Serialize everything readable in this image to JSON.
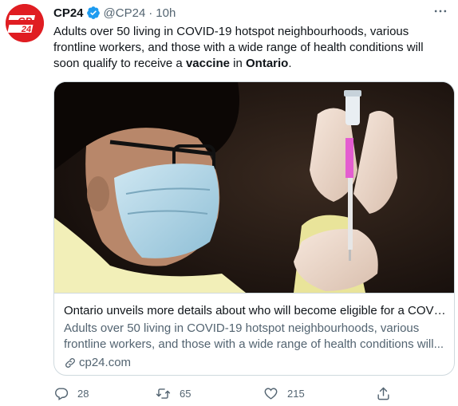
{
  "author": {
    "name": "CP24",
    "handle": "@CP24",
    "separator": "·",
    "time": "10h",
    "avatar_logo_text": "CP24",
    "verified": true
  },
  "tweet": {
    "text_part1": "Adults over 50 living in COVID-19 hotspot neighbourhoods, various frontline workers, and those with a wide range of health conditions will soon qualify to receive a ",
    "bold1": "vaccine",
    "text_part2": " in ",
    "bold2": "Ontario",
    "text_part3": "."
  },
  "card": {
    "image_alt": "Health worker wearing a mask and gloves preparing a vaccine syringe",
    "title": "Ontario unveils more details about who will become eligible for a COVI...",
    "description": "Adults over 50 living in COVID-19 hotspot neighbourhoods, various frontline workers, and those with a wide range of health conditions will...",
    "domain": "cp24.com"
  },
  "actions": {
    "replies": "28",
    "retweets": "65",
    "likes": "215"
  },
  "colors": {
    "brand_red": "#e01d22",
    "verified_blue": "#1d9bf0",
    "secondary_text": "#536471",
    "border": "#cfd9de"
  },
  "icons": [
    "verified-badge-icon",
    "more-icon",
    "link-icon",
    "reply-icon",
    "retweet-icon",
    "like-icon",
    "share-icon"
  ]
}
